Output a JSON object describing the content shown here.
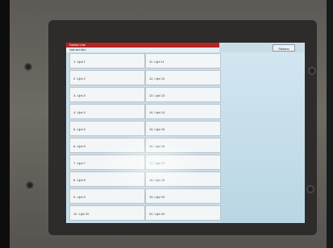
{
  "window": {
    "title": "Sanka Line",
    "subtitle": "Vali sini liini",
    "close_label": "Ststano"
  },
  "lines_left": [
    "1. Lijni 1",
    "2. Lijni 2",
    "3. Lijni 3",
    "4. Lijni 4",
    "5. Lijni 5",
    "6. Lijni 6",
    "7. Lijni 7",
    "8. Lijni 8",
    "9. Lijni 9",
    "10. Lijni 10"
  ],
  "lines_right": [
    "11. Lijni 11",
    "12. Lijni 12",
    "13. Lijni 13",
    "14. Lijni 14",
    "15. Lijni 15",
    "16. Lijni 16",
    "17. Lijni 17",
    "18. Lijni 18",
    "19. Lijni 19",
    "20. Lijni 20"
  ]
}
